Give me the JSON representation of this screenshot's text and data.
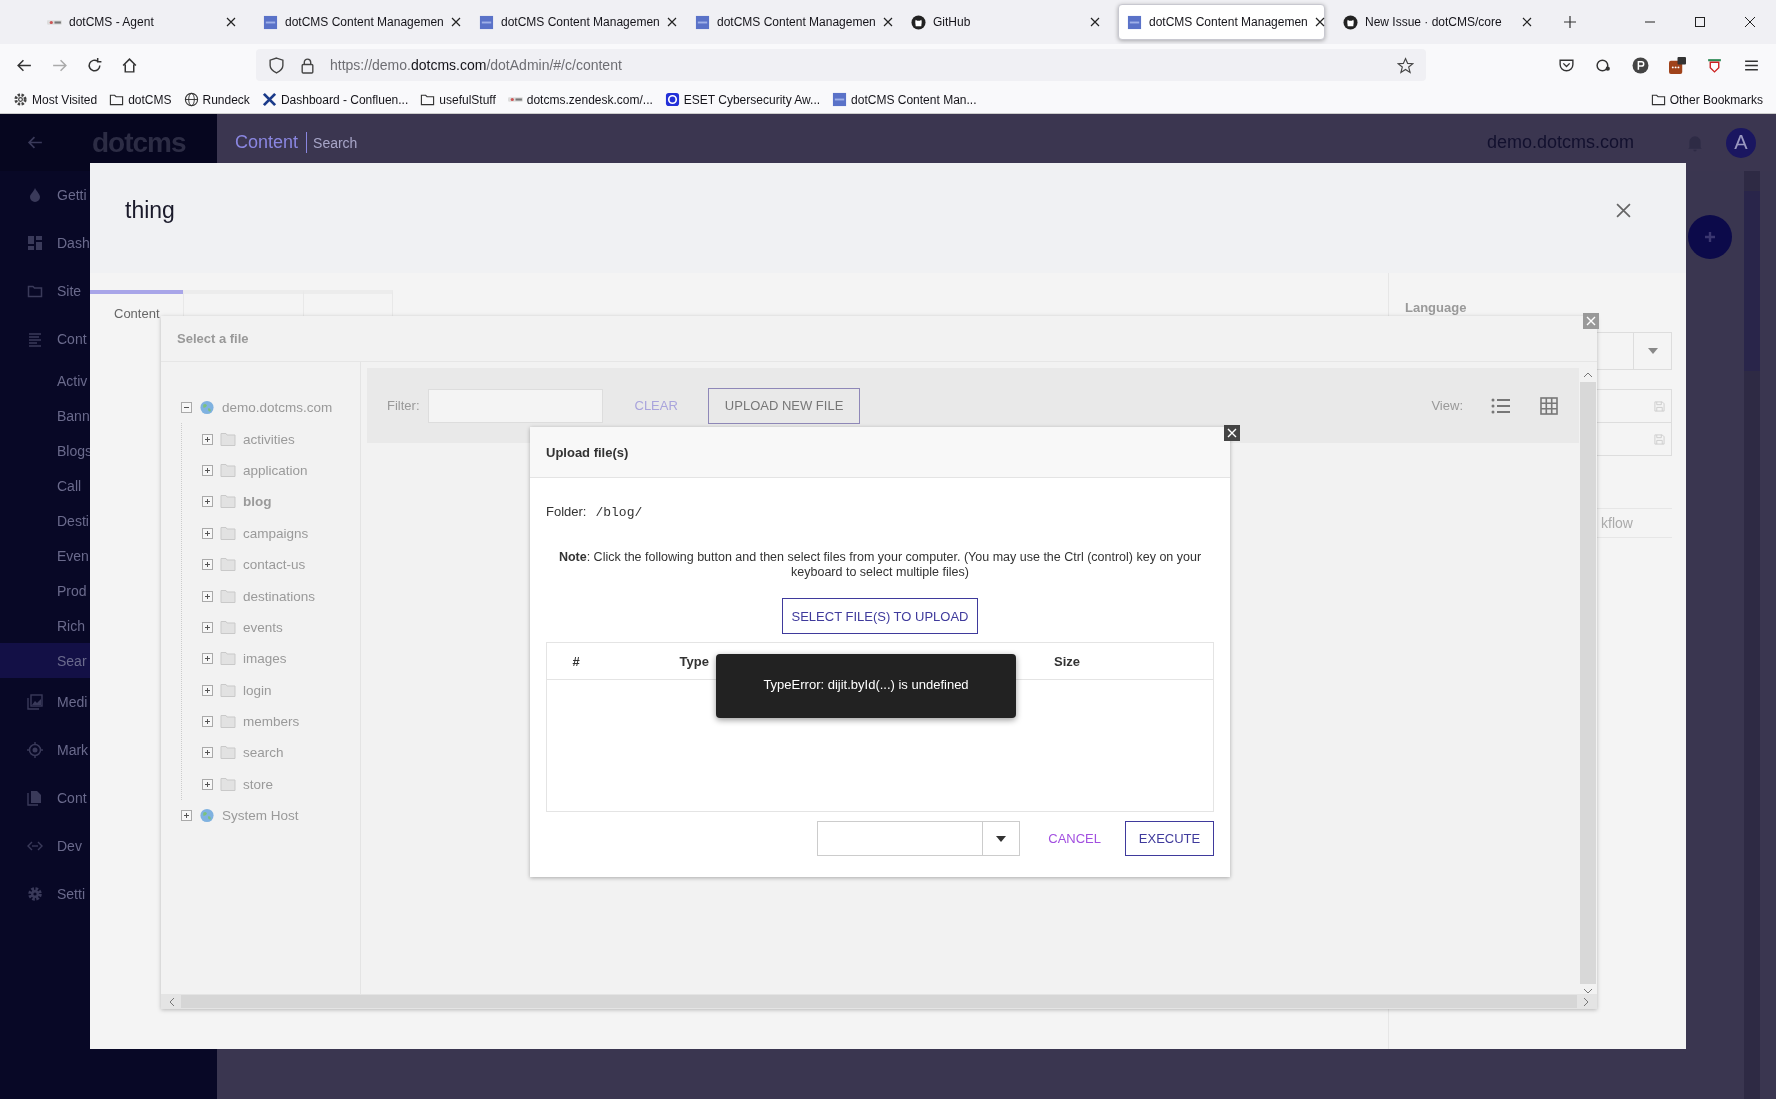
{
  "browser": {
    "tabs": [
      {
        "title": "dotCMS - Agent",
        "kind": "dotcms",
        "selected": false
      },
      {
        "title": "dotCMS Content Managemen",
        "kind": "square",
        "selected": false
      },
      {
        "title": "dotCMS Content Managemen",
        "kind": "square",
        "selected": false
      },
      {
        "title": "dotCMS Content Managemen",
        "kind": "square",
        "selected": false
      },
      {
        "title": "GitHub",
        "kind": "github",
        "selected": false
      },
      {
        "title": "dotCMS Content Managemen",
        "kind": "square",
        "selected": true
      },
      {
        "title": "New Issue · dotCMS/core",
        "kind": "github",
        "selected": false
      }
    ],
    "address": {
      "prefix": "https://demo.",
      "domain": "dotcms.com",
      "path": "/dotAdmin/#/c/content"
    },
    "bookmarks": [
      {
        "label": "Most Visited",
        "kind": "gear"
      },
      {
        "label": "dotCMS",
        "kind": "folder"
      },
      {
        "label": "Rundeck",
        "kind": "globe"
      },
      {
        "label": "Dashboard - Confluen...",
        "kind": "cross"
      },
      {
        "label": "usefulStuff",
        "kind": "folder"
      },
      {
        "label": "dotcms.zendesk.com/...",
        "kind": "dotcms"
      },
      {
        "label": "ESET Cybersecurity Aw...",
        "kind": "eset"
      },
      {
        "label": "dotCMS Content Man...",
        "kind": "square"
      }
    ],
    "other_bookmarks": "Other Bookmarks"
  },
  "app": {
    "logo": "dotcms",
    "breadcrumb": [
      "Content",
      "Search"
    ],
    "site": "demo.dotcms.com",
    "avatar": "A",
    "sidebar": [
      {
        "label": "Getti",
        "kind": "flame",
        "selected": false
      },
      {
        "label": "Dash",
        "kind": "dashboard",
        "selected": false
      },
      {
        "label": "Site",
        "kind": "folder",
        "selected": false
      },
      {
        "label": "Cont",
        "kind": "lines",
        "selected": false
      },
      {
        "label": "Activ",
        "kind": "sub",
        "selected": false
      },
      {
        "label": "Bann",
        "kind": "sub",
        "selected": false
      },
      {
        "label": "Blogs",
        "kind": "sub",
        "selected": false
      },
      {
        "label": "Call",
        "kind": "sub",
        "selected": false
      },
      {
        "label": "Desti",
        "kind": "sub",
        "selected": false
      },
      {
        "label": "Even",
        "kind": "sub",
        "selected": false
      },
      {
        "label": "Prod",
        "kind": "sub",
        "selected": false
      },
      {
        "label": "Rich",
        "kind": "sub",
        "selected": false
      },
      {
        "label": "Sear",
        "kind": "sub",
        "selected": true
      },
      {
        "label": "Medi",
        "kind": "image",
        "selected": false
      },
      {
        "label": "Mark",
        "kind": "target",
        "selected": false
      },
      {
        "label": "Cont",
        "kind": "files",
        "selected": false
      },
      {
        "label": "Dev",
        "kind": "code",
        "selected": false
      },
      {
        "label": "Setti",
        "kind": "gear",
        "selected": false
      }
    ]
  },
  "modal": {
    "title": "thing",
    "tabs": [
      {
        "label": "Content",
        "selected": true
      }
    ],
    "language_label": "Language",
    "workflow_text": "kflow"
  },
  "file_dialog": {
    "title": "Select a file",
    "tree": [
      {
        "label": "demo.dotcms.com",
        "kind": "host",
        "expanded": true,
        "selected": false,
        "children": [
          {
            "label": "activities",
            "kind": "folder",
            "expanded": false,
            "selected": false
          },
          {
            "label": "application",
            "kind": "folder",
            "expanded": false,
            "selected": false
          },
          {
            "label": "blog",
            "kind": "folder",
            "expanded": false,
            "selected": true
          },
          {
            "label": "campaigns",
            "kind": "folder",
            "expanded": false,
            "selected": false
          },
          {
            "label": "contact-us",
            "kind": "folder",
            "expanded": false,
            "selected": false
          },
          {
            "label": "destinations",
            "kind": "folder",
            "expanded": false,
            "selected": false
          },
          {
            "label": "events",
            "kind": "folder",
            "expanded": false,
            "selected": false
          },
          {
            "label": "images",
            "kind": "folder",
            "expanded": false,
            "selected": false
          },
          {
            "label": "login",
            "kind": "folder",
            "expanded": false,
            "selected": false
          },
          {
            "label": "members",
            "kind": "folder",
            "expanded": false,
            "selected": false
          },
          {
            "label": "search",
            "kind": "folder",
            "expanded": false,
            "selected": false
          },
          {
            "label": "store",
            "kind": "folder",
            "expanded": false,
            "selected": false
          }
        ]
      },
      {
        "label": "System Host",
        "kind": "host",
        "expanded": false,
        "selected": false
      }
    ],
    "filter_label": "Filter:",
    "clear": "CLEAR",
    "upload": "UPLOAD NEW FILE",
    "view_label": "View:",
    "view_modes": [
      {
        "kind": "list"
      },
      {
        "kind": "grid"
      }
    ]
  },
  "upload_dialog": {
    "title": "Upload file(s)",
    "folder_label": "Folder:",
    "folder": "/blog/",
    "note": "**Note**: Click the following button and then select files from your computer. (You may use the Ctrl (control) key on your keyboard to select multiple files)",
    "select_button": "SELECT FILE(S) TO UPLOAD",
    "columns": [
      "#",
      "Type",
      "Size"
    ],
    "cancel": "CANCEL",
    "execute": "EXECUTE"
  },
  "toast": "TypeError: dijit.byId(...) is undefined"
}
